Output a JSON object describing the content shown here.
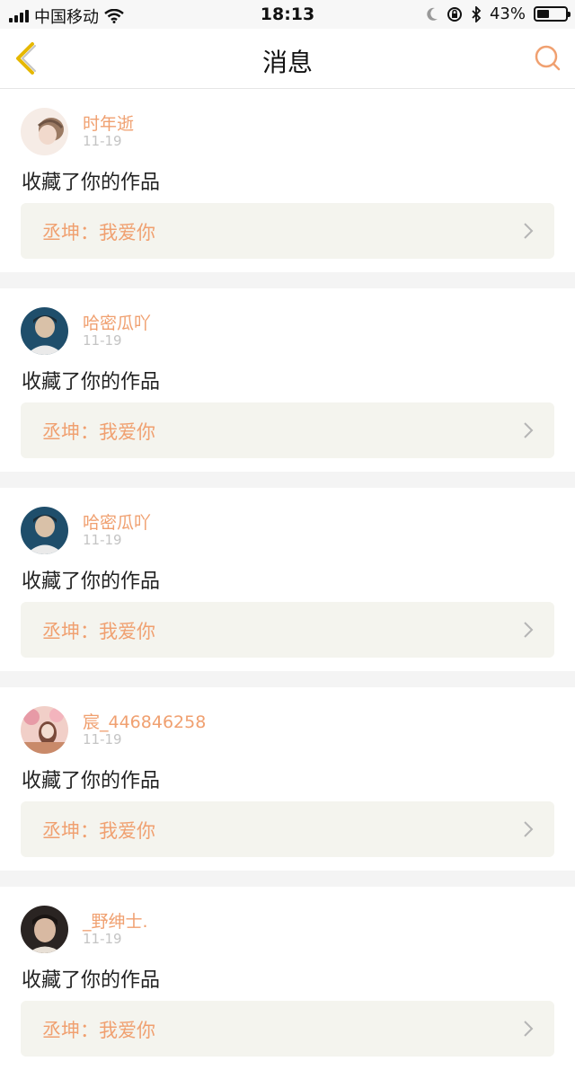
{
  "status_bar": {
    "carrier": "中国移动",
    "time": "18:13",
    "battery": "43%",
    "battery_level": 0.43,
    "icons": [
      "signal-icon",
      "wifi-icon",
      "moon-icon",
      "rotation-lock-icon",
      "bluetooth-icon",
      "battery-icon"
    ]
  },
  "nav": {
    "title": "消息",
    "back_icon": "chevron-left-icon",
    "search_icon": "search-icon"
  },
  "colors": {
    "accent": "#f0a070",
    "back_arrow": "#e6b800",
    "card_link_bg": "#f4f4ee",
    "separator": "#f4f4f4"
  },
  "messages": [
    {
      "user": "时年逝",
      "date": "11-19",
      "action": "收藏了你的作品",
      "work": "丞坤：我爱你"
    },
    {
      "user": "哈密瓜吖",
      "date": "11-19",
      "action": "收藏了你的作品",
      "work": "丞坤：我爱你"
    },
    {
      "user": "哈密瓜吖",
      "date": "11-19",
      "action": "收藏了你的作品",
      "work": "丞坤：我爱你"
    },
    {
      "user": "宸_446846258",
      "date": "11-19",
      "action": "收藏了你的作品",
      "work": "丞坤：我爱你"
    },
    {
      "user": "_野绅士.",
      "date": "11-19",
      "action": "收藏了你的作品",
      "work": "丞坤：我爱你"
    }
  ]
}
